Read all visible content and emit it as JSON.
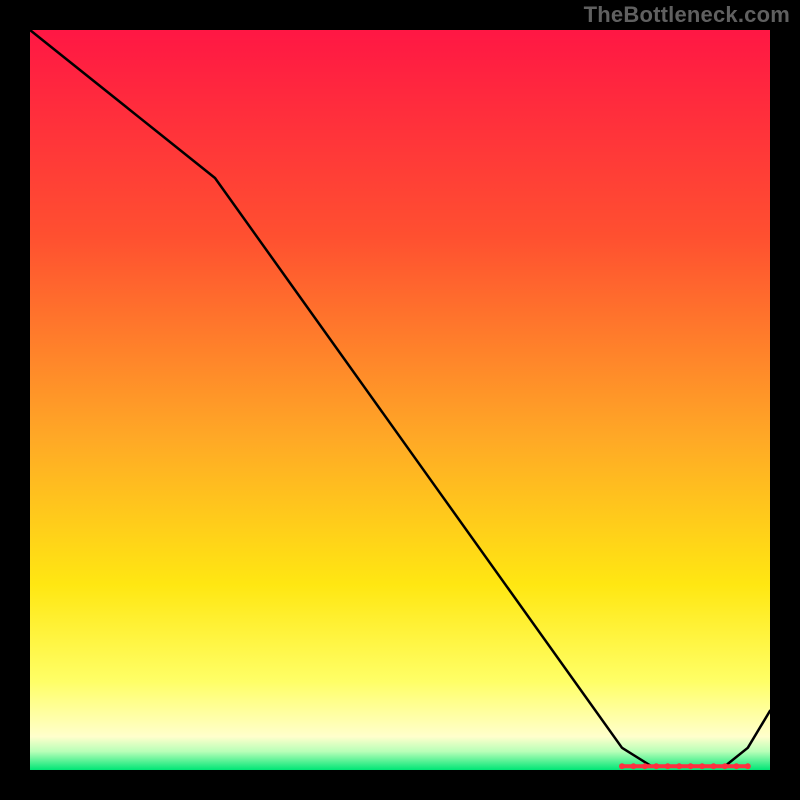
{
  "watermark": "TheBottleneck.com",
  "chart_data": {
    "type": "line",
    "title": "",
    "xlabel": "",
    "ylabel": "",
    "xlim": [
      0,
      100
    ],
    "ylim": [
      0,
      100
    ],
    "background_gradient_stops": [
      {
        "offset": 0,
        "color": "#ff1744"
      },
      {
        "offset": 0.28,
        "color": "#ff5030"
      },
      {
        "offset": 0.55,
        "color": "#ffa826"
      },
      {
        "offset": 0.75,
        "color": "#ffe712"
      },
      {
        "offset": 0.88,
        "color": "#ffff66"
      },
      {
        "offset": 0.955,
        "color": "#ffffcc"
      },
      {
        "offset": 0.975,
        "color": "#b8ffb8"
      },
      {
        "offset": 1.0,
        "color": "#00e676"
      }
    ],
    "curve": {
      "x": [
        0,
        5,
        15,
        25,
        35,
        45,
        55,
        65,
        75,
        80,
        84,
        86,
        88,
        91,
        94,
        97,
        100
      ],
      "y": [
        100,
        96,
        88,
        80,
        66,
        52,
        38,
        24,
        10,
        3,
        0.5,
        0.5,
        0.5,
        0.5,
        0.6,
        3,
        8
      ]
    },
    "flat_segment": {
      "x_start": 80,
      "x_end": 97,
      "y": 0.5,
      "marker_color": "#ff3040",
      "marker_radius": 3
    }
  }
}
